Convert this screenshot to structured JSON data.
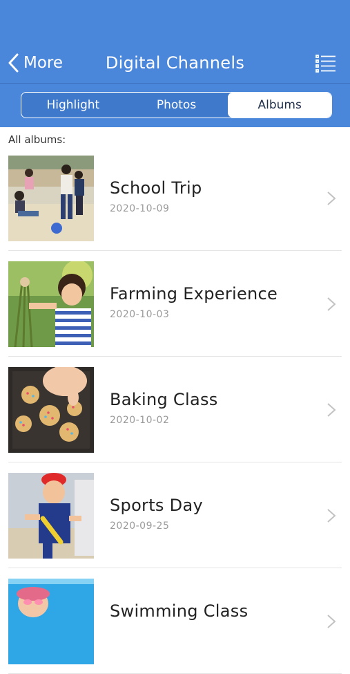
{
  "header": {
    "back_label": "More",
    "title": "Digital Channels",
    "background": "#4a86d9"
  },
  "tabs": [
    {
      "label": "Highlight",
      "active": false
    },
    {
      "label": "Photos",
      "active": false
    },
    {
      "label": "Albums",
      "active": true
    }
  ],
  "section_label": "All albums:",
  "albums": [
    {
      "title": "School Trip",
      "date": "2020-10-09",
      "thumbnail": "children-playing-park-photo"
    },
    {
      "title": "Farming Experience",
      "date": "2020-10-03",
      "thumbnail": "girl-holding-vegetables-photo"
    },
    {
      "title": "Baking Class",
      "date": "2020-10-02",
      "thumbnail": "cookies-on-tray-photo"
    },
    {
      "title": "Sports Day",
      "date": "2020-09-25",
      "thumbnail": "boy-running-relay-photo"
    },
    {
      "title": "Swimming Class",
      "date": "",
      "thumbnail": "child-in-pool-photo"
    }
  ]
}
